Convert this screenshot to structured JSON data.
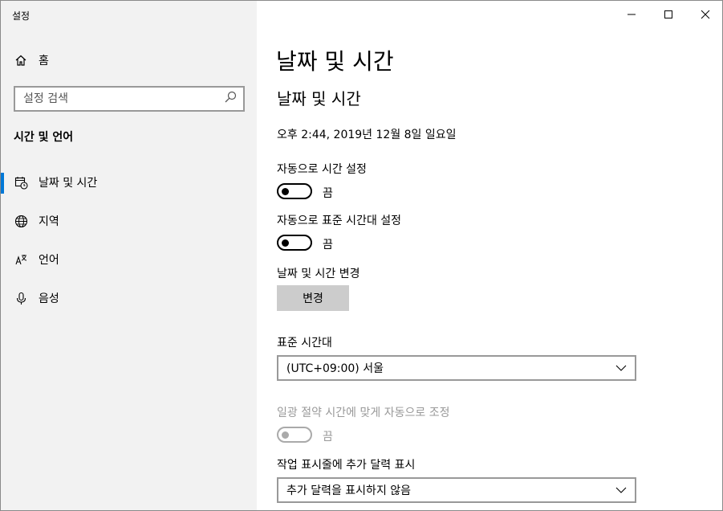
{
  "app": {
    "title": "설정"
  },
  "sidebar": {
    "home_label": "홈",
    "search_placeholder": "설정 검색",
    "section_label": "시간 및 언어",
    "items": [
      {
        "label": "날짜 및 시간",
        "icon": "calendar-clock-icon",
        "active": true
      },
      {
        "label": "지역",
        "icon": "globe-icon",
        "active": false
      },
      {
        "label": "언어",
        "icon": "language-icon",
        "active": false
      },
      {
        "label": "음성",
        "icon": "microphone-icon",
        "active": false
      }
    ]
  },
  "main": {
    "page_title": "날짜 및 시간",
    "section_title": "날짜 및 시간",
    "current_datetime": "오후 2:44, 2019년 12월 8일 일요일",
    "auto_time": {
      "label": "자동으로 시간 설정",
      "state": "끔"
    },
    "auto_timezone": {
      "label": "자동으로 표준 시간대 설정",
      "state": "끔"
    },
    "change_datetime": {
      "label": "날짜 및 시간 변경",
      "button": "변경"
    },
    "timezone": {
      "label": "표준 시간대",
      "value": "(UTC+09:00) 서울"
    },
    "dst": {
      "label": "일광 절약 시간에 맞게 자동으로 조정",
      "state": "끔",
      "disabled": true
    },
    "taskbar_calendar": {
      "label": "작업 표시줄에 추가 달력 표시",
      "value": "추가 달력을 표시하지 않음"
    }
  },
  "colors": {
    "accent": "#0078d7",
    "sidebar_bg": "#f2f2f2"
  }
}
